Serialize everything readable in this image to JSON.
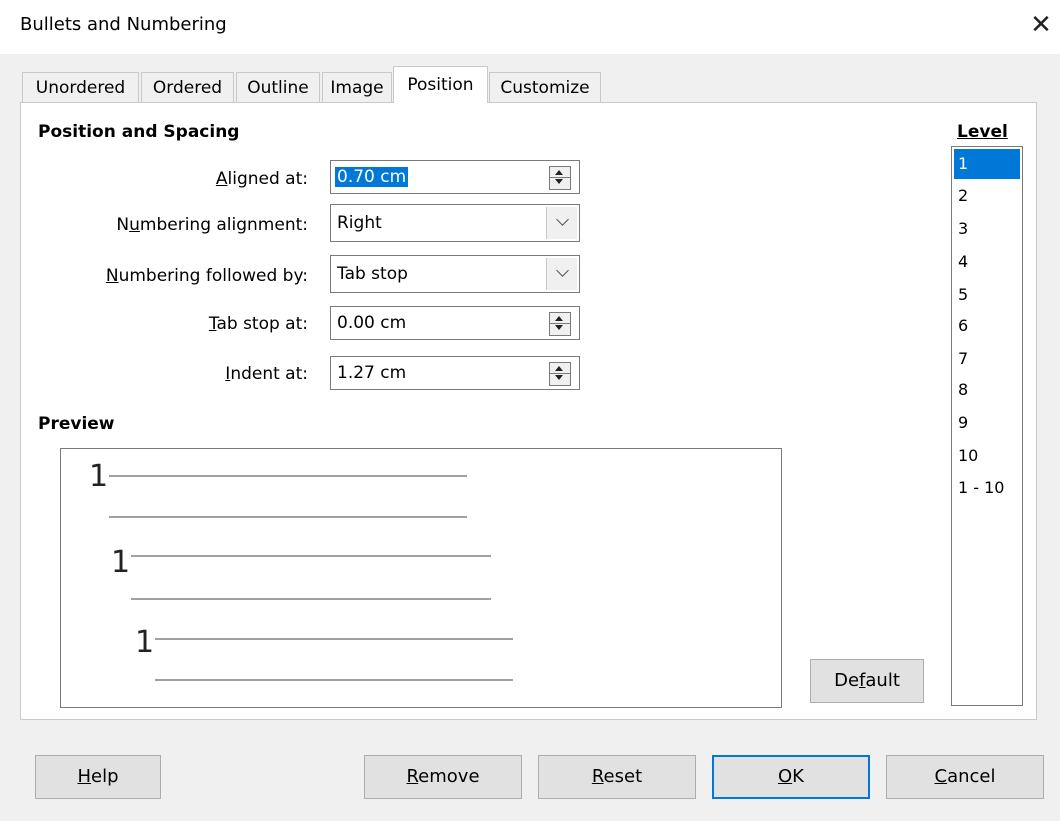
{
  "window": {
    "title": "Bullets and Numbering",
    "close_glyph": "✕"
  },
  "tabs": [
    "Unordered",
    "Ordered",
    "Outline",
    "Image",
    "Position",
    "Customize"
  ],
  "active_tab": "Position",
  "section": {
    "heading": "Position and Spacing"
  },
  "fields": {
    "aligned_at": {
      "label_pre": "",
      "label_ul": "A",
      "label_post": "ligned at:",
      "value": "0.70 cm"
    },
    "numbering_alignment": {
      "label_pre": "N",
      "label_ul": "u",
      "label_post": "mbering alignment:",
      "value": "Right"
    },
    "numbering_followed_by": {
      "label_pre": "",
      "label_ul": "N",
      "label_post": "umbering followed by:",
      "value": "Tab stop"
    },
    "tab_stop_at": {
      "label_pre": "",
      "label_ul": "T",
      "label_post": "ab stop at:",
      "value": "0.00 cm"
    },
    "indent_at": {
      "label_pre": "",
      "label_ul": "I",
      "label_post": "ndent at:",
      "value": "1.27 cm"
    }
  },
  "preview": {
    "heading": "Preview",
    "numbers": [
      "1",
      "1",
      "1"
    ]
  },
  "level": {
    "heading": "Level",
    "items": [
      "1",
      "2",
      "3",
      "4",
      "5",
      "6",
      "7",
      "8",
      "9",
      "10",
      "1 - 10"
    ],
    "selected": "1"
  },
  "buttons": {
    "default": {
      "pre": "De",
      "ul": "f",
      "post": "ault"
    },
    "help": {
      "pre": "",
      "ul": "H",
      "post": "elp"
    },
    "remove": {
      "pre": "",
      "ul": "R",
      "post": "emove"
    },
    "reset": {
      "pre": "",
      "ul": "R",
      "post": "eset"
    },
    "ok": {
      "pre": "",
      "ul": "O",
      "post": "K"
    },
    "cancel": {
      "pre": "",
      "ul": "C",
      "post": "ancel"
    }
  }
}
